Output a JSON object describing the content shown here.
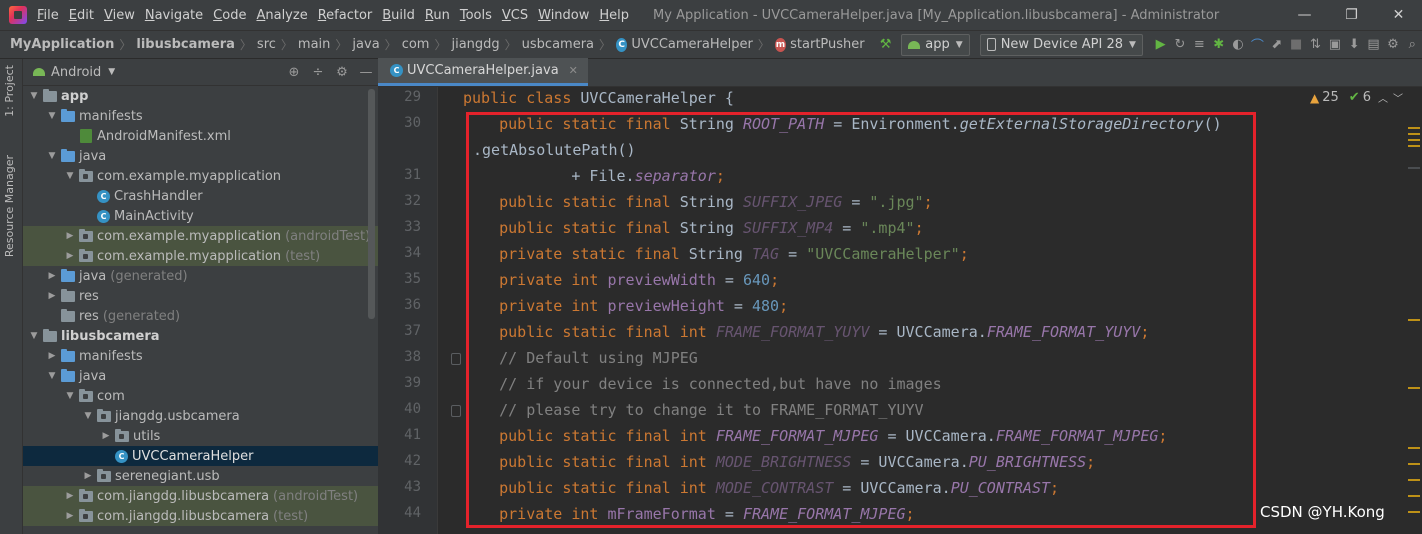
{
  "menubar": {
    "items": [
      "File",
      "Edit",
      "View",
      "Navigate",
      "Code",
      "Analyze",
      "Refactor",
      "Build",
      "Run",
      "Tools",
      "VCS",
      "Window",
      "Help"
    ],
    "window_title": "My Application - UVCCameraHelper.java [My_Application.libusbcamera] - Administrator"
  },
  "navbar": {
    "breadcrumbs": [
      "MyApplication",
      "libusbcamera",
      "src",
      "main",
      "java",
      "com",
      "jiangdg",
      "usbcamera",
      "UVCCameraHelper",
      "startPusher"
    ],
    "run_config": "app",
    "device": "New Device API 28"
  },
  "side_tabs": {
    "project": "1: Project",
    "resource_manager": "Resource Manager"
  },
  "project": {
    "view": "Android",
    "tree": [
      {
        "label": "app",
        "suffix": "",
        "depth": 0
      },
      {
        "label": "manifests",
        "suffix": "",
        "depth": 1
      },
      {
        "label": "AndroidManifest.xml",
        "suffix": "",
        "depth": 2
      },
      {
        "label": "java",
        "suffix": "",
        "depth": 1
      },
      {
        "label": "com.example.myapplication",
        "suffix": "",
        "depth": 2
      },
      {
        "label": "CrashHandler",
        "suffix": "",
        "depth": 3
      },
      {
        "label": "MainActivity",
        "suffix": "",
        "depth": 3
      },
      {
        "label": "com.example.myapplication",
        "suffix": "(androidTest)",
        "depth": 2
      },
      {
        "label": "com.example.myapplication",
        "suffix": "(test)",
        "depth": 2
      },
      {
        "label": "java",
        "suffix": "(generated)",
        "depth": 1
      },
      {
        "label": "res",
        "suffix": "",
        "depth": 1
      },
      {
        "label": "res",
        "suffix": "(generated)",
        "depth": 1
      },
      {
        "label": "libusbcamera",
        "suffix": "",
        "depth": 0
      },
      {
        "label": "manifests",
        "suffix": "",
        "depth": 1
      },
      {
        "label": "java",
        "suffix": "",
        "depth": 1
      },
      {
        "label": "com",
        "suffix": "",
        "depth": 2
      },
      {
        "label": "jiangdg.usbcamera",
        "suffix": "",
        "depth": 3
      },
      {
        "label": "utils",
        "suffix": "",
        "depth": 4
      },
      {
        "label": "UVCCameraHelper",
        "suffix": "",
        "depth": 4
      },
      {
        "label": "serenegiant.usb",
        "suffix": "",
        "depth": 3
      },
      {
        "label": "com.jiangdg.libusbcamera",
        "suffix": "(androidTest)",
        "depth": 2
      },
      {
        "label": "com.jiangdg.libusbcamera",
        "suffix": "(test)",
        "depth": 2
      }
    ]
  },
  "editor": {
    "tab_label": "UVCCameraHelper.java",
    "line_numbers": [
      "29",
      "30",
      "31",
      "32",
      "33",
      "34",
      "35",
      "36",
      "37",
      "38",
      "39",
      "40",
      "41",
      "42",
      "43",
      "44"
    ],
    "inspection": {
      "warnings": "25",
      "weak_warnings": "6"
    }
  },
  "code_lines": [
    [
      [
        "kw",
        "public class "
      ],
      [
        "ty",
        "UVCCameraHelper {"
      ]
    ],
    [
      [
        "kw",
        "    public static final "
      ],
      [
        "ty",
        "String "
      ],
      [
        "cn",
        "ROOT_PATH"
      ],
      [
        "pl",
        " = Environment."
      ],
      [
        "md",
        "getExternalStorageDirectory"
      ],
      [
        "pl",
        "()"
      ]
    ],
    [
      [
        "pl",
        ".getAbsolutePath()"
      ]
    ],
    [
      [
        "pl",
        "            + File."
      ],
      [
        "cn",
        "separator"
      ],
      [
        "kw",
        ";"
      ]
    ],
    [
      [
        "kw",
        "    public static final "
      ],
      [
        "ty",
        "String "
      ],
      [
        "ucn",
        "SUFFIX_JPEG"
      ],
      [
        "pl",
        " = "
      ],
      [
        "st",
        "\".jpg\""
      ],
      [
        "kw",
        ";"
      ]
    ],
    [
      [
        "kw",
        "    public static final "
      ],
      [
        "ty",
        "String "
      ],
      [
        "ucn",
        "SUFFIX_MP4"
      ],
      [
        "pl",
        " = "
      ],
      [
        "st",
        "\".mp4\""
      ],
      [
        "kw",
        ";"
      ]
    ],
    [
      [
        "kw",
        "    private static final "
      ],
      [
        "ty",
        "String "
      ],
      [
        "ucn",
        "TAG"
      ],
      [
        "pl",
        " = "
      ],
      [
        "st",
        "\"UVCCameraHelper\""
      ],
      [
        "kw",
        ";"
      ]
    ],
    [
      [
        "kw",
        "    private int "
      ],
      [
        "fld",
        "previewWidth"
      ],
      [
        "pl",
        " = "
      ],
      [
        "nm",
        "640"
      ],
      [
        "kw",
        ";"
      ]
    ],
    [
      [
        "kw",
        "    private int "
      ],
      [
        "fld",
        "previewHeight"
      ],
      [
        "pl",
        " = "
      ],
      [
        "nm",
        "480"
      ],
      [
        "kw",
        ";"
      ]
    ],
    [
      [
        "kw",
        "    public static final int "
      ],
      [
        "ucn",
        "FRAME_FORMAT_YUYV"
      ],
      [
        "pl",
        " = UVCCamera."
      ],
      [
        "cn",
        "FRAME_FORMAT_YUYV"
      ],
      [
        "kw",
        ";"
      ]
    ],
    [
      [
        "cm",
        "    // Default using MJPEG"
      ]
    ],
    [
      [
        "cm",
        "    // if your device is connected,but have no images"
      ]
    ],
    [
      [
        "cm",
        "    // please try to change it to FRAME_FORMAT_YUYV"
      ]
    ],
    [
      [
        "kw",
        "    public static final int "
      ],
      [
        "cn",
        "FRAME_FORMAT_MJPEG"
      ],
      [
        "pl",
        " = UVCCamera."
      ],
      [
        "cn",
        "FRAME_FORMAT_MJPEG"
      ],
      [
        "kw",
        ";"
      ]
    ],
    [
      [
        "kw",
        "    public static final int "
      ],
      [
        "ucn",
        "MODE_BRIGHTNESS"
      ],
      [
        "pl",
        " = UVCCamera."
      ],
      [
        "cn",
        "PU_BRIGHTNESS"
      ],
      [
        "kw",
        ";"
      ]
    ],
    [
      [
        "kw",
        "    public static final int "
      ],
      [
        "ucn",
        "MODE_CONTRAST"
      ],
      [
        "pl",
        " = UVCCamera."
      ],
      [
        "cn",
        "PU_CONTRAST"
      ],
      [
        "kw",
        ";"
      ]
    ],
    [
      [
        "kw",
        "    private int "
      ],
      [
        "fld",
        "mFrameFormat"
      ],
      [
        "pl",
        " = "
      ],
      [
        "cn",
        "FRAME_FORMAT_MJPEG"
      ],
      [
        "kw",
        ";"
      ]
    ]
  ],
  "watermark": "CSDN @YH.Kong",
  "colors": {
    "highlight_box": "#e4222b",
    "selection": "#0d293e",
    "test_row": "#4a5440"
  }
}
